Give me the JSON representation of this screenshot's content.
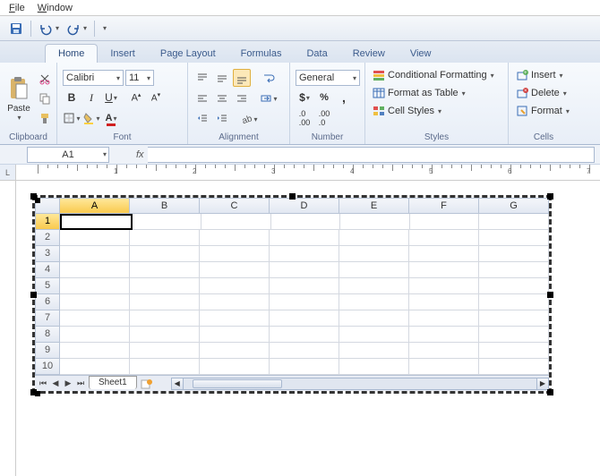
{
  "menu": {
    "file": "File",
    "window": "Window"
  },
  "tabs": {
    "home": "Home",
    "insert": "Insert",
    "page_layout": "Page Layout",
    "formulas": "Formulas",
    "data": "Data",
    "review": "Review",
    "view": "View"
  },
  "ribbon": {
    "clipboard": {
      "label": "Clipboard",
      "paste": "Paste"
    },
    "font": {
      "label": "Font",
      "name": "Calibri",
      "size": "11"
    },
    "alignment": {
      "label": "Alignment"
    },
    "number": {
      "label": "Number",
      "format": "General"
    },
    "styles": {
      "label": "Styles",
      "cond": "Conditional Formatting",
      "table": "Format as Table",
      "cell": "Cell Styles"
    },
    "cells": {
      "label": "Cells",
      "insert": "Insert",
      "delete": "Delete",
      "format": "Format"
    }
  },
  "namebox": "A1",
  "fx": "fx",
  "sheet": {
    "columns": [
      "A",
      "B",
      "C",
      "D",
      "E",
      "F",
      "G"
    ],
    "rows": [
      "1",
      "2",
      "3",
      "4",
      "5",
      "6",
      "7",
      "8",
      "9",
      "10"
    ],
    "active_col": 0,
    "active_row": 0,
    "tab": "Sheet1"
  },
  "ruler": {
    "marks": [
      "1",
      "2",
      "3",
      "4",
      "5",
      "6",
      "7"
    ]
  }
}
